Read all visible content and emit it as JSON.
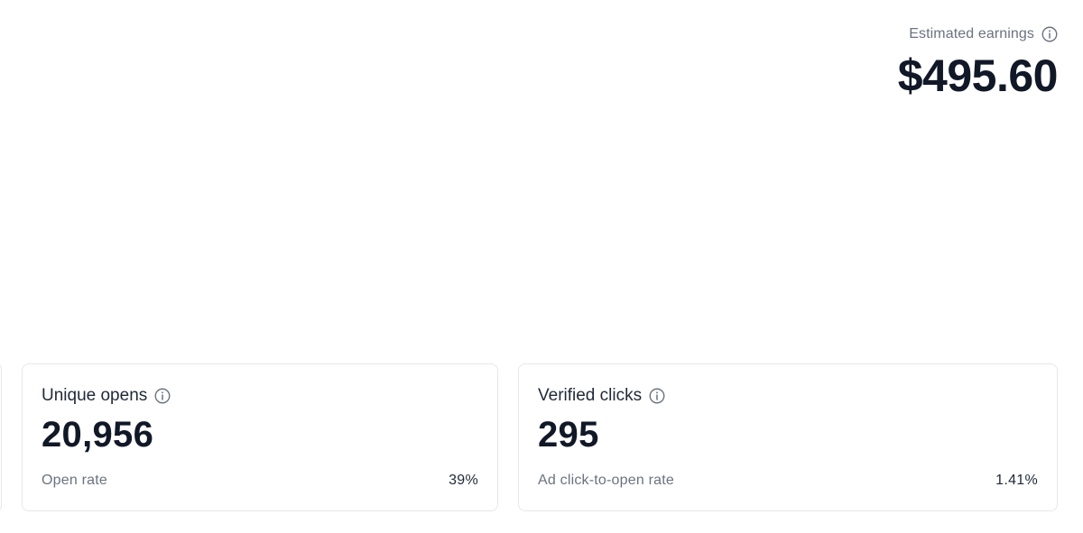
{
  "earnings": {
    "label": "Estimated earnings",
    "value": "$495.60",
    "info_icon": "info-icon"
  },
  "cards": [
    {
      "title": "Unique opens",
      "value": "20,956",
      "footer_label": "Open rate",
      "footer_value": "39%",
      "info_icon": "info-icon"
    },
    {
      "title": "Verified clicks",
      "value": "295",
      "footer_label": "Ad click-to-open rate",
      "footer_value": "1.41%",
      "info_icon": "info-icon"
    }
  ],
  "colors": {
    "text_primary": "#111827",
    "text_secondary": "#6b7280",
    "border": "#e5e7eb",
    "background": "#ffffff"
  }
}
